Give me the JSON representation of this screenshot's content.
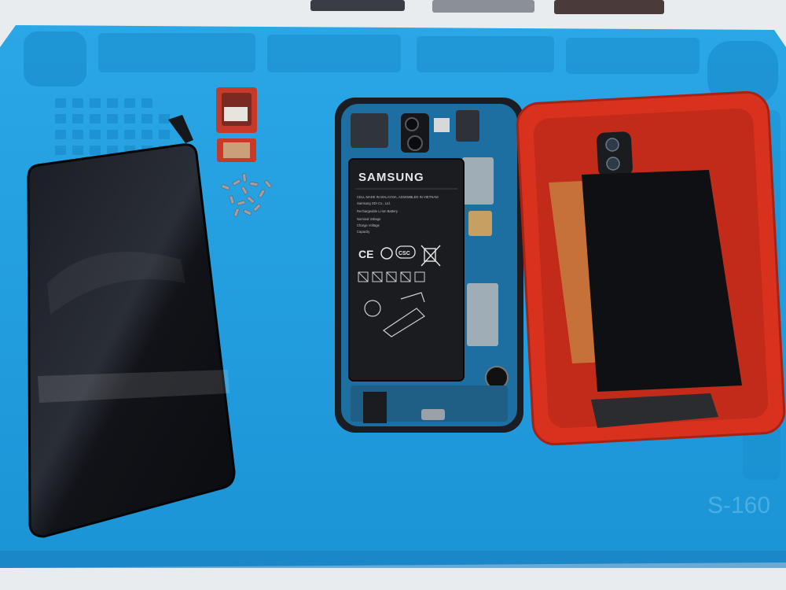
{
  "colors": {
    "mat": "#1f9bdc",
    "mat_dark": "#1580c0",
    "mat_light": "#3db0ea",
    "desk": "#e9ecef",
    "screen": "#0d0f14",
    "board": "#1c6fa0",
    "battery": "#1a1c20",
    "frame_red": "#d8321f",
    "copper": "#c8793e",
    "sim_tray": "#c63a2a"
  },
  "battery": {
    "brand": "SAMSUNG",
    "text_lines": [
      "CELL MADE IN MALAYSIA, ASSEMBLED IN VIETNAM",
      "Samsung SDI Co., Ltd.",
      "Rechargeable Li-ion Battery",
      "Nominal Voltage",
      "Charge Voltage",
      "Capacity"
    ],
    "marks": [
      "CE",
      "CSC"
    ]
  },
  "mat_etching": {
    "model": "S-160"
  }
}
